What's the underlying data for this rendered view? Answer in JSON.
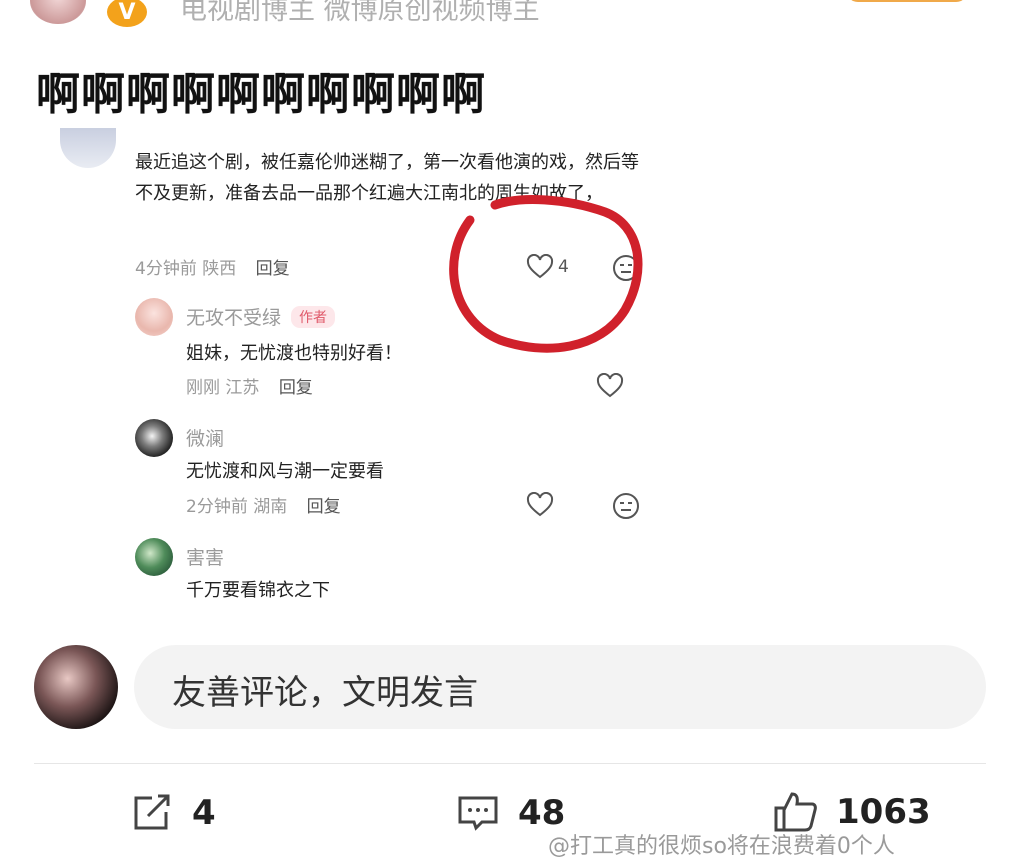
{
  "header": {
    "subtitle": "电视剧博主 微博原创视频博主",
    "verified_badge": "V"
  },
  "post_title": "啊啊啊啊啊啊啊啊啊啊",
  "comments": [
    {
      "text": "最近追这个剧，被任嘉伦帅迷糊了，第一次看他演的戏，然后等不及更新，准备去品一品那个红遍大江南北的周生如故了，",
      "time": "4分钟前",
      "location": "陕西",
      "reply_label": "回复",
      "likes": "4"
    }
  ],
  "replies": [
    {
      "username": "无攻不受绿",
      "tag": "作者",
      "text": "姐妹，无忧渡也特别好看！",
      "time": "刚刚",
      "location": "江苏",
      "reply_label": "回复"
    },
    {
      "username": "微澜",
      "text": "无忧渡和风与潮一定要看",
      "time": "2分钟前",
      "location": "湖南",
      "reply_label": "回复"
    },
    {
      "username": "害害",
      "text": "千万要看锦衣之下"
    }
  ],
  "input": {
    "placeholder": "友善评论，文明发言"
  },
  "bottom_bar": {
    "share_count": "4",
    "comment_count": "48",
    "like_count": "1063"
  },
  "watermark": "@打工真的很烦so将在浪费着0个人",
  "colors": {
    "accent_red": "#d0212b",
    "author_tag": "#e05a6a",
    "badge_orange": "#f3a21b"
  }
}
